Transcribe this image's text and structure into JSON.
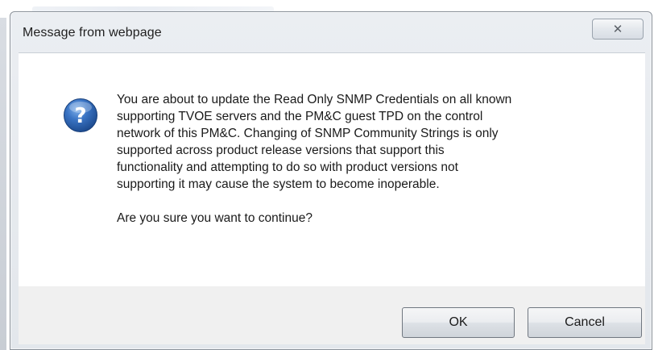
{
  "dialog": {
    "title": "Message from webpage",
    "close_glyph": "✕",
    "icon": "question-icon",
    "message_lines": [
      "You are about to update the Read Only SNMP Credentials on all known",
      "supporting TVOE servers and the PM&C guest TPD on the control",
      "network of this PM&C. Changing of SNMP Community Strings is only",
      "supported across product release versions that support this",
      "functionality and attempting to do so with product versions not",
      "supporting it may cause the system to become inoperable."
    ],
    "confirm_text": "Are you sure you want to continue?",
    "ok_label": "OK",
    "cancel_label": "Cancel"
  },
  "colors": {
    "icon_blue": "#2a5fa8",
    "footer_bg": "#f0f0f0",
    "frame_bg": "#e3e7ec"
  }
}
